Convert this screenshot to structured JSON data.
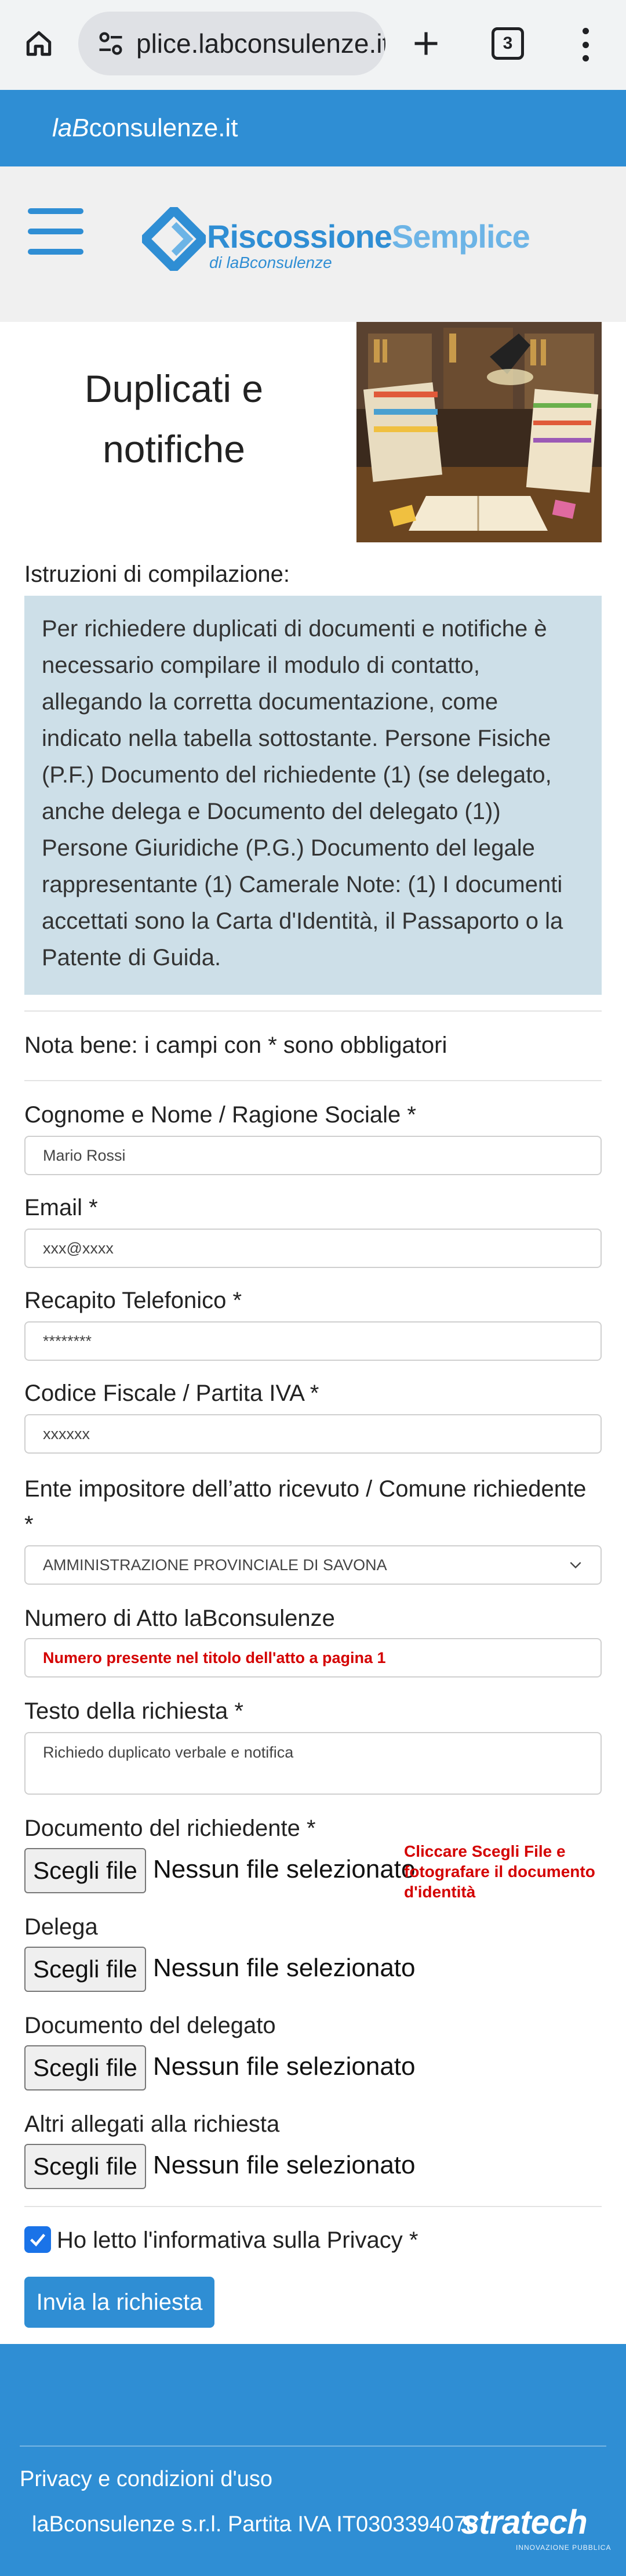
{
  "browser": {
    "url": "plice.labconsulenze.it",
    "tab_count": "3"
  },
  "topbar": {
    "brand_italic": "laB",
    "brand_rest": "consulenze.it"
  },
  "logo": {
    "name_part1": "Riscossione",
    "name_part2": "Semplice",
    "subtitle": "di laBconsulenze"
  },
  "page": {
    "title_line1": "Duplicati e",
    "title_line2": "notifiche"
  },
  "instructions": {
    "label": "Istruzioni di compilazione:",
    "text": "Per richiedere duplicati di documenti e notifiche è necessario compilare il modulo di contatto, allegando la corretta documentazione, come indicato nella tabella sottostante. Persone Fisiche (P.F.) Documento del richiedente (1) (se delegato, anche delega e Documento del delegato (1)) Persone Giuridiche (P.G.) Documento del legale rappresentante (1) Camerale Note: (1) I documenti accettati sono la Carta d'Identità, il Passaporto o la Patente di Guida."
  },
  "form": {
    "note": "Nota bene: i campi con * sono obbligatori",
    "name_label": "Cognome e Nome / Ragione Sociale *",
    "name_value": "Mario Rossi",
    "email_label": "Email *",
    "email_value": "xxx@xxxx",
    "phone_label": "Recapito Telefonico *",
    "phone_value": "********",
    "cf_label": "Codice Fiscale / Partita IVA *",
    "cf_value": "xxxxxx",
    "ente_label_line1": "Ente impositore dell’atto ricevuto / Comune richiedente",
    "ente_label_line2": "*",
    "ente_value": "AMMINISTRAZIONE PROVINCIALE DI SAVONA",
    "atto_label": "Numero di Atto laBconsulenze",
    "atto_placeholder": "Numero presente nel titolo dell'atto a pagina 1",
    "testo_label": "Testo della richiesta *",
    "testo_value": "Richiedo duplicato verbale e notifica",
    "doc_label": "Documento del richiedente *",
    "doc_hint": "Cliccare Scegli File e fotografare il documento d'identità",
    "delega_label": "Delega",
    "delegato_label": "Documento del delegato",
    "altri_label": "Altri allegati alla richiesta",
    "file_button": "Scegli file",
    "file_none": "Nessun file selezionato",
    "privacy_label": "Ho letto l'informativa sulla Privacy *",
    "privacy_checked": true,
    "submit_label": "Invia la richiesta"
  },
  "footer": {
    "privacy_link": "Privacy e condizioni d'uso",
    "company": "laBconsulenze s.r.l. Partita IVA IT0303394078",
    "partner_logo": "stratech",
    "partner_tagline": "INNOVAZIONE PUBBLICA"
  },
  "colors": {
    "primary": "#2f8ed4",
    "instructions_bg": "#cddfe8",
    "hint_red": "#d40000",
    "checkbox": "#1a73e8"
  }
}
